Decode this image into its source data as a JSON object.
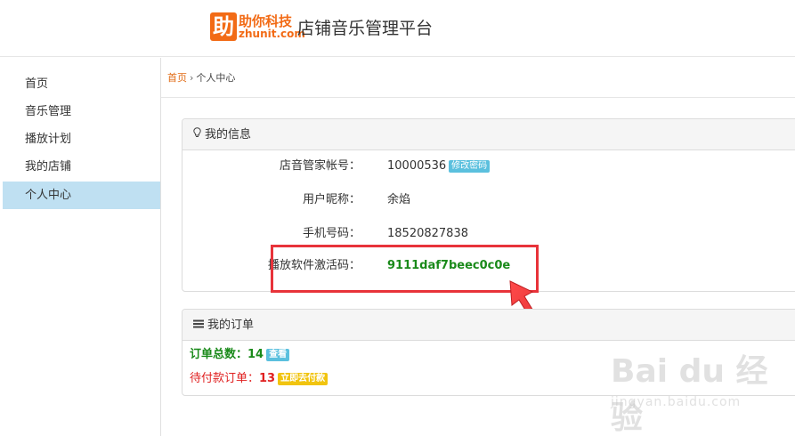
{
  "header": {
    "logo_glyph": "助",
    "logo_cn": "助你科技",
    "logo_en": "zhunit.com",
    "title": "店铺音乐管理平台",
    "brand_color": "#f26b16"
  },
  "sidebar": {
    "items": [
      {
        "label": "首页",
        "active": false
      },
      {
        "label": "音乐管理",
        "active": false
      },
      {
        "label": "播放计划",
        "active": false
      },
      {
        "label": "我的店铺",
        "active": false
      },
      {
        "label": "个人中心",
        "active": true
      }
    ],
    "active_color": "#bfe0f2"
  },
  "breadcrumb": {
    "home": "首页",
    "separator": "›",
    "current": "个人中心"
  },
  "info_panel": {
    "title": "我的信息",
    "icon": "lightbulb-icon",
    "rows": [
      {
        "label": "店音管家帐号：",
        "value": "10000536",
        "action": "修改密码"
      },
      {
        "label": "用户昵称：",
        "value": "余焰"
      },
      {
        "label": "手机号码：",
        "value": "18520827838"
      },
      {
        "label": "播放软件激活码：",
        "value": "9111daf7beec0c0e"
      }
    ]
  },
  "order_panel": {
    "title": "我的订单",
    "icon": "list-icon",
    "total_label": "订单总数：",
    "total_count": "14",
    "view_action": "查看",
    "pending_label": "待付款订单：",
    "pending_count": "13",
    "pay_action": "立即去付款"
  },
  "watermark": {
    "main": "Bai du 经验",
    "sub": "jingyan.baidu.com"
  },
  "colors": {
    "highlight": "#e8333a",
    "activation_code": "#1a8a1a",
    "pending": "#e02020",
    "badge_blue": "#5bc0de",
    "badge_yellow": "#f1c40f"
  }
}
